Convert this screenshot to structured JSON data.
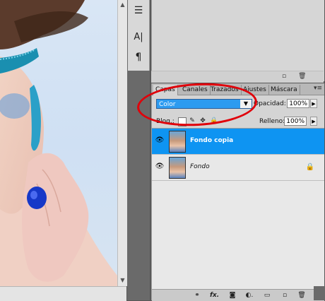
{
  "tools": {
    "icons": [
      "layer-comps-icon",
      "character-icon",
      "paragraph-icon"
    ],
    "glyphs": [
      "☰",
      "A|",
      "¶"
    ]
  },
  "layers_panel": {
    "tabs": [
      "Capas",
      "Canales",
      "Trazados",
      "Ajustes",
      "Máscara"
    ],
    "active_tab": "Capas",
    "blend_mode": "Color",
    "opacity_label": "Opacidad:",
    "opacity_value": "100%",
    "lock_label": "Bloq.:",
    "fill_label": "Relleno:",
    "fill_value": "100%",
    "layers": [
      {
        "name": "Fondo copia",
        "selected": true,
        "visible": true,
        "locked": false
      },
      {
        "name": "Fondo",
        "selected": false,
        "visible": true,
        "locked": true
      }
    ],
    "bottom_icons": [
      "link-layers-icon",
      "fx-icon",
      "add-mask-icon",
      "adjustment-layer-icon",
      "new-group-icon",
      "new-layer-icon",
      "trash-icon"
    ],
    "bottom_glyphs": [
      "⚭",
      "fx.",
      "◙",
      "◐.",
      "▭",
      "▫",
      "🗑"
    ]
  },
  "colors": {
    "selection": "#0e94f2",
    "highlight_circle": "#e0000a",
    "blend_field": "#2c9bf0"
  }
}
